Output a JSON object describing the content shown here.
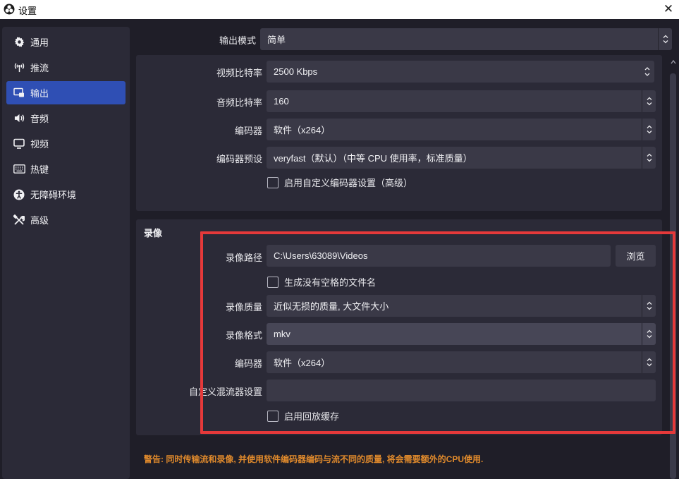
{
  "window": {
    "title": "设置"
  },
  "sidebar": {
    "items": [
      {
        "label": "通用",
        "icon": "gear-icon"
      },
      {
        "label": "推流",
        "icon": "antenna-icon"
      },
      {
        "label": "输出",
        "icon": "output-icon",
        "active": true
      },
      {
        "label": "音频",
        "icon": "speaker-icon"
      },
      {
        "label": "视频",
        "icon": "monitor-icon"
      },
      {
        "label": "热键",
        "icon": "keyboard-icon"
      },
      {
        "label": "无障碍环境",
        "icon": "accessibility-icon"
      },
      {
        "label": "高级",
        "icon": "tools-icon"
      }
    ]
  },
  "output_mode": {
    "label": "输出模式",
    "value": "简单"
  },
  "streaming": {
    "video_bitrate": {
      "label": "视频比特率",
      "value": "2500 Kbps"
    },
    "audio_bitrate": {
      "label": "音频比特率",
      "value": "160"
    },
    "encoder": {
      "label": "编码器",
      "value": "软件（x264）"
    },
    "encoder_preset": {
      "label": "编码器预设",
      "value": "veryfast（默认）（中等 CPU 使用率，标准质量）"
    },
    "custom_encoder": {
      "label": "启用自定义编码器设置（高级）",
      "checked": false
    }
  },
  "recording": {
    "title": "录像",
    "path": {
      "label": "录像路径",
      "value": "C:\\Users\\63089\\Videos",
      "browse": "浏览"
    },
    "no_space": {
      "label": "生成没有空格的文件名",
      "checked": false
    },
    "quality": {
      "label": "录像质量",
      "value": "近似无损的质量, 大文件大小"
    },
    "format": {
      "label": "录像格式",
      "value": "mkv"
    },
    "encoder": {
      "label": "编码器",
      "value": "软件（x264）"
    },
    "muxer": {
      "label": "自定义混流器设置",
      "value": ""
    },
    "replay_buffer": {
      "label": "启用回放缓存",
      "checked": false
    }
  },
  "warning": "警告: 同时传输流和录像, 并使用软件编码器编码与流不同的质量, 将会需要额外的CPU使用.",
  "colors": {
    "accent": "#2f4fb4",
    "highlight": "#e5393a",
    "warning": "#e08a2c",
    "panel": "#2b2a37",
    "background": "#1f1e28"
  }
}
